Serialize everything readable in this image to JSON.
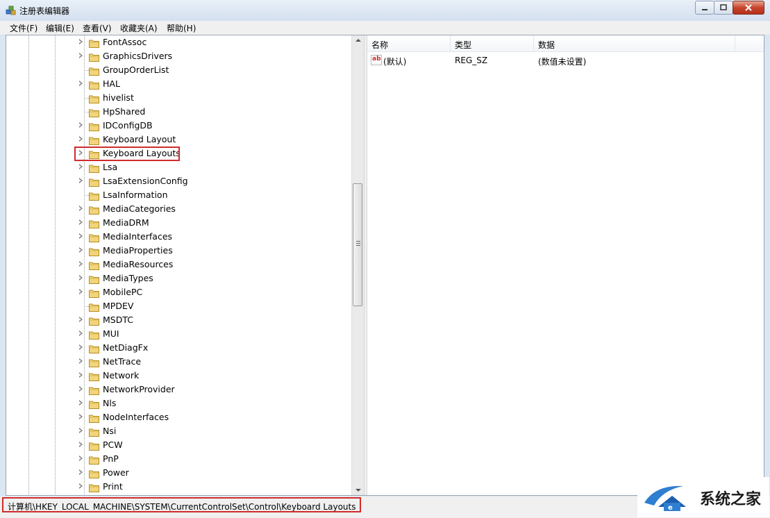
{
  "window": {
    "title": "注册表编辑器"
  },
  "menu": {
    "items": [
      "文件(F)",
      "编辑(E)",
      "查看(V)",
      "收藏夹(A)",
      "帮助(H)"
    ]
  },
  "tree": {
    "nodes": [
      {
        "label": "FontAssoc",
        "expandable": true
      },
      {
        "label": "GraphicsDrivers",
        "expandable": true
      },
      {
        "label": "GroupOrderList",
        "expandable": false
      },
      {
        "label": "HAL",
        "expandable": true
      },
      {
        "label": "hivelist",
        "expandable": false
      },
      {
        "label": "HpShared",
        "expandable": false
      },
      {
        "label": "IDConfigDB",
        "expandable": true
      },
      {
        "label": "Keyboard Layout",
        "expandable": true
      },
      {
        "label": "Keyboard Layouts",
        "expandable": true,
        "selected": true
      },
      {
        "label": "Lsa",
        "expandable": true
      },
      {
        "label": "LsaExtensionConfig",
        "expandable": true
      },
      {
        "label": "LsaInformation",
        "expandable": false
      },
      {
        "label": "MediaCategories",
        "expandable": true
      },
      {
        "label": "MediaDRM",
        "expandable": true
      },
      {
        "label": "MediaInterfaces",
        "expandable": true
      },
      {
        "label": "MediaProperties",
        "expandable": true
      },
      {
        "label": "MediaResources",
        "expandable": true
      },
      {
        "label": "MediaTypes",
        "expandable": true
      },
      {
        "label": "MobilePC",
        "expandable": true
      },
      {
        "label": "MPDEV",
        "expandable": false
      },
      {
        "label": "MSDTC",
        "expandable": true
      },
      {
        "label": "MUI",
        "expandable": true
      },
      {
        "label": "NetDiagFx",
        "expandable": true
      },
      {
        "label": "NetTrace",
        "expandable": true
      },
      {
        "label": "Network",
        "expandable": true
      },
      {
        "label": "NetworkProvider",
        "expandable": true
      },
      {
        "label": "Nls",
        "expandable": true
      },
      {
        "label": "NodeInterfaces",
        "expandable": true
      },
      {
        "label": "Nsi",
        "expandable": true
      },
      {
        "label": "PCW",
        "expandable": true
      },
      {
        "label": "PnP",
        "expandable": true
      },
      {
        "label": "Power",
        "expandable": true
      },
      {
        "label": "Print",
        "expandable": true
      }
    ]
  },
  "values": {
    "headers": [
      "名称",
      "类型",
      "数据"
    ],
    "rows": [
      {
        "name": "(默认)",
        "type": "REG_SZ",
        "data": "(数值未设置)"
      }
    ]
  },
  "status": {
    "path": "计算机\\HKEY_LOCAL_MACHINE\\SYSTEM\\CurrentControlSet\\Control\\Keyboard Layouts"
  },
  "watermark": {
    "text": "系统之家"
  },
  "colors": {
    "highlight_box": "#d02b2b",
    "folder": "#e8c35a"
  }
}
